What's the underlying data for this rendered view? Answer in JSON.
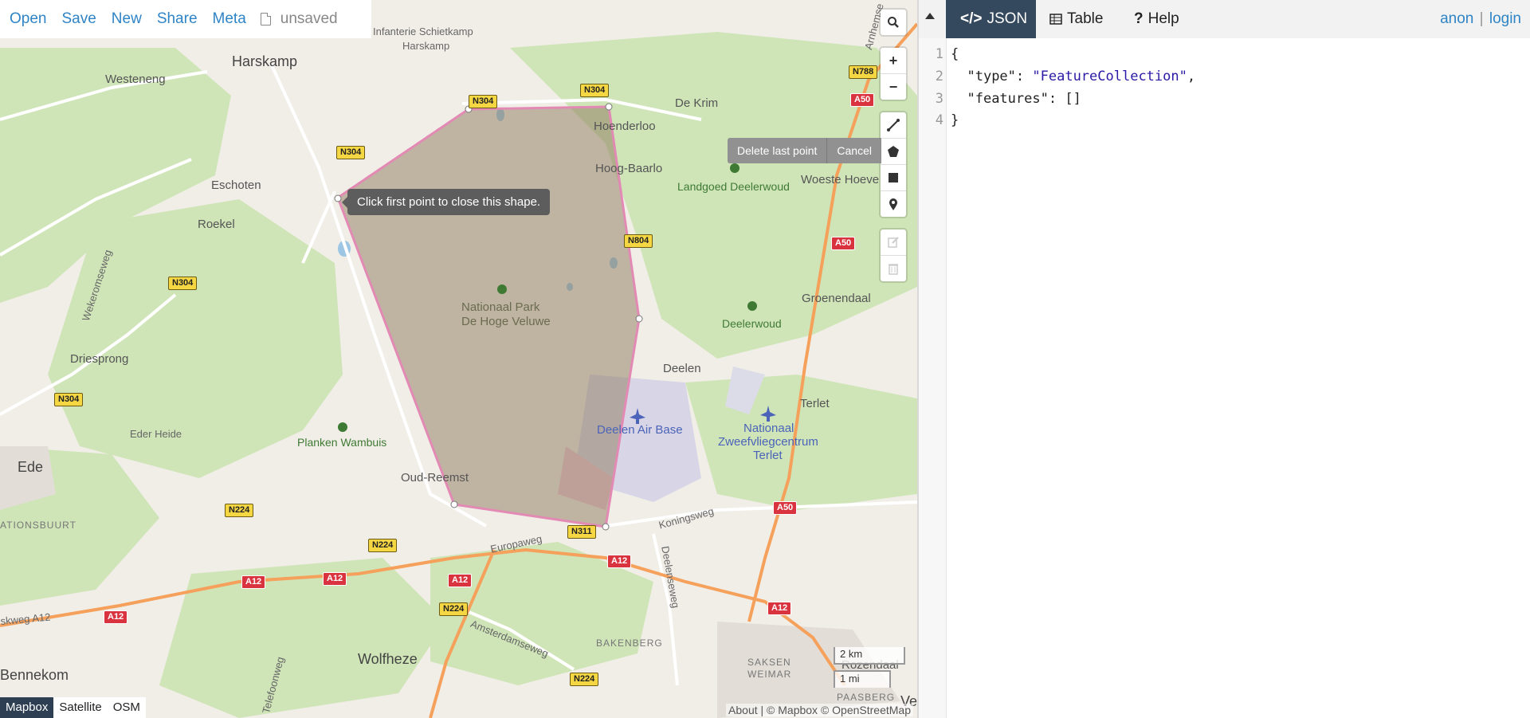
{
  "top_menu": {
    "open": "Open",
    "save": "Save",
    "new": "New",
    "share": "Share",
    "meta": "Meta",
    "file_status": "unsaved"
  },
  "draw": {
    "delete_last_point": "Delete last point",
    "cancel": "Cancel",
    "tooltip": "Click first point to close this shape."
  },
  "map_controls": {
    "zoom_in": "+",
    "zoom_out": "−"
  },
  "layers": [
    {
      "label": "Mapbox",
      "active": true
    },
    {
      "label": "Satellite",
      "active": false
    },
    {
      "label": "OSM",
      "active": false
    }
  ],
  "attribution": {
    "about": "About",
    "mapbox": "© Mapbox",
    "osm": "© OpenStreetMap"
  },
  "scale": {
    "km": "2 km",
    "mi": "1 mi"
  },
  "map_labels": {
    "harskamp": "Harskamp",
    "infanterie": "Infanterie Schietkamp",
    "infanterie2": "Harskamp",
    "westeneng": "Westeneng",
    "de_krim": "De Krim",
    "hoenderloo": "Hoenderloo",
    "hoog_baarlo": "Hoog-Baarlo",
    "eschoten": "Eschoten",
    "roekel": "Roekel",
    "landgoed": "Landgoed Deelerwoud",
    "woeste_hoeve": "Woeste Hoeve",
    "groenendaal": "Groenendaal",
    "deelerwoud": "Deelerwoud",
    "nat_park_1": "Nationaal Park",
    "nat_park_2": "De Hoge Veluwe",
    "wekeromseweg": "Wekeromseweg",
    "driesprong": "Driesprong",
    "deelen": "Deelen",
    "terlet": "Terlet",
    "deelen_air": "Deelen Air Base",
    "zweef_1": "Nationaal",
    "zweef_2": "Zweefvliegcentrum",
    "zweef_3": "Terlet",
    "eder_heide": "Eder Heide",
    "planken": "Planken Wambuis",
    "ede": "Ede",
    "oud_reemst": "Oud-Reemst",
    "ationsbuurt": "ATIONSBUURT",
    "koningsweg": "Koningsweg",
    "europaweg": "Europaweg",
    "deelenseweg": "Deelenseweg",
    "amsterdamseweg": "Amsterdamseweg",
    "skweg_a12": "skweg A12",
    "bakenberg": "BAKENBERG",
    "saksen_1": "SAKSEN",
    "saksen_2": "WEIMAR",
    "rozendaal": "Rozendaal",
    "paasberg": "PAASBERG",
    "wolfheze": "Wolfheze",
    "bennekom": "Bennekom",
    "telefoonweg": "Telefoonweg",
    "arnhemse": "Arnhemse",
    "ve": "Ve"
  },
  "road_shields": {
    "n304": "N304",
    "n788": "N788",
    "a50": "A50",
    "n804": "N804",
    "n224": "N224",
    "n311": "N311",
    "a12": "A12"
  },
  "editor": {
    "tabs": {
      "json": "JSON",
      "table": "Table",
      "help": "Help"
    },
    "user": {
      "anon": "anon",
      "sep": "|",
      "login": "login"
    },
    "line_numbers": [
      "1",
      "2",
      "3",
      "4"
    ],
    "code": {
      "open_brace": "{",
      "type_key": "\"type\"",
      "type_val": "\"FeatureCollection\"",
      "features_key": "\"features\"",
      "features_val": "[]",
      "close_brace": "}"
    }
  },
  "colors": {
    "accent": "#2f84c5",
    "active_tab": "#34495e",
    "draw_polygon_fill": "#8d7a5c",
    "draw_polygon_stroke": "#e28ab4"
  }
}
